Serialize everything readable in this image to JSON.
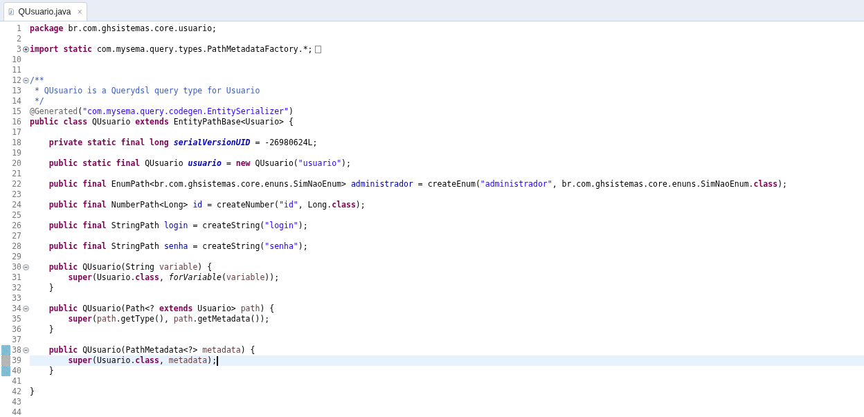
{
  "tab": {
    "title": "QUsuario.java",
    "selected": true
  },
  "lines": [
    {
      "number": "1",
      "current": false,
      "marked": false,
      "tokens": [
        {
          "kind": "kw",
          "text": "package"
        },
        {
          "kind": "plain",
          "text": " br.com.ghsistemas.core.usuario;"
        }
      ]
    },
    {
      "number": "2",
      "current": false,
      "marked": false
    },
    {
      "number": "3",
      "current": false,
      "marked": false,
      "collapsed": true,
      "tokens": [
        {
          "kind": "kw",
          "text": "import static"
        },
        {
          "kind": "plain",
          "text": " com.mysema.query.types.PathMetadataFactory.*;"
        }
      ]
    },
    {
      "number": "10",
      "current": false,
      "marked": false
    },
    {
      "number": "11",
      "current": false,
      "marked": false
    },
    {
      "number": "12",
      "current": false,
      "marked": false,
      "collapsed": false,
      "tokens": [
        {
          "kind": "comment",
          "text": "/**"
        }
      ]
    },
    {
      "number": "13",
      "current": false,
      "marked": false,
      "tokens": [
        {
          "kind": "comment",
          "text": " * QUsuario is a Querydsl query type for Usuario"
        }
      ]
    },
    {
      "number": "14",
      "current": false,
      "marked": false,
      "tokens": [
        {
          "kind": "comment",
          "text": " */"
        }
      ]
    },
    {
      "number": "15",
      "current": false,
      "marked": false,
      "tokens": [
        {
          "kind": "annotation",
          "text": "@Generated"
        },
        {
          "kind": "plain",
          "text": "("
        },
        {
          "kind": "string",
          "text": "\"com.mysema.query.codegen.EntitySerializer\""
        },
        {
          "kind": "plain",
          "text": ")"
        }
      ]
    },
    {
      "number": "16",
      "current": false,
      "marked": false,
      "tokens": [
        {
          "kind": "kw",
          "text": "public class"
        },
        {
          "kind": "plain",
          "text": " QUsuario "
        },
        {
          "kind": "kw",
          "text": "extends"
        },
        {
          "kind": "plain",
          "text": " EntityPathBase<Usuario> {"
        }
      ]
    },
    {
      "number": "17",
      "current": false,
      "marked": false
    },
    {
      "number": "18",
      "current": false,
      "marked": false,
      "tokens": [
        {
          "kind": "kw",
          "text": "    private static final long "
        },
        {
          "kind": "static_field",
          "text": "serialVersionUID"
        },
        {
          "kind": "plain",
          "text": " = -26980624L;"
        }
      ]
    },
    {
      "number": "19",
      "current": false,
      "marked": false
    },
    {
      "number": "20",
      "current": false,
      "marked": false,
      "tokens": [
        {
          "kind": "kw",
          "text": "    public static final"
        },
        {
          "kind": "plain",
          "text": " QUsuario "
        },
        {
          "kind": "static_field",
          "text": "usuario"
        },
        {
          "kind": "plain",
          "text": " = "
        },
        {
          "kind": "kw",
          "text": "new"
        },
        {
          "kind": "plain",
          "text": " QUsuario("
        },
        {
          "kind": "string",
          "text": "\"usuario\""
        },
        {
          "kind": "plain",
          "text": ");"
        }
      ]
    },
    {
      "number": "21",
      "current": false,
      "marked": false
    },
    {
      "number": "22",
      "current": false,
      "marked": false,
      "tokens": [
        {
          "kind": "kw",
          "text": "    public final"
        },
        {
          "kind": "plain",
          "text": " EnumPath<br.com.ghsistemas.core.enuns.SimNaoEnum> "
        },
        {
          "kind": "field",
          "text": "administrador"
        },
        {
          "kind": "plain",
          "text": " = createEnum("
        },
        {
          "kind": "string",
          "text": "\"administrador\""
        },
        {
          "kind": "plain",
          "text": ", br.com.ghsistemas.core.enuns.SimNaoEnum."
        },
        {
          "kind": "kw",
          "text": "class"
        },
        {
          "kind": "plain",
          "text": ");"
        }
      ]
    },
    {
      "number": "23",
      "current": false,
      "marked": false
    },
    {
      "number": "24",
      "current": false,
      "marked": false,
      "tokens": [
        {
          "kind": "kw",
          "text": "    public final"
        },
        {
          "kind": "plain",
          "text": " NumberPath<Long> "
        },
        {
          "kind": "field",
          "text": "id"
        },
        {
          "kind": "plain",
          "text": " = createNumber("
        },
        {
          "kind": "string",
          "text": "\"id\""
        },
        {
          "kind": "plain",
          "text": ", Long."
        },
        {
          "kind": "kw",
          "text": "class"
        },
        {
          "kind": "plain",
          "text": ");"
        }
      ]
    },
    {
      "number": "25",
      "current": false,
      "marked": false
    },
    {
      "number": "26",
      "current": false,
      "marked": false,
      "tokens": [
        {
          "kind": "kw",
          "text": "    public final"
        },
        {
          "kind": "plain",
          "text": " StringPath "
        },
        {
          "kind": "field",
          "text": "login"
        },
        {
          "kind": "plain",
          "text": " = createString("
        },
        {
          "kind": "string",
          "text": "\"login\""
        },
        {
          "kind": "plain",
          "text": ");"
        }
      ]
    },
    {
      "number": "27",
      "current": false,
      "marked": false
    },
    {
      "number": "28",
      "current": false,
      "marked": false,
      "tokens": [
        {
          "kind": "kw",
          "text": "    public final"
        },
        {
          "kind": "plain",
          "text": " StringPath "
        },
        {
          "kind": "field",
          "text": "senha"
        },
        {
          "kind": "plain",
          "text": " = createString("
        },
        {
          "kind": "string",
          "text": "\"senha\""
        },
        {
          "kind": "plain",
          "text": ");"
        }
      ]
    },
    {
      "number": "29",
      "current": false,
      "marked": false
    },
    {
      "number": "30",
      "current": false,
      "marked": false,
      "collapsed": false,
      "tokens": [
        {
          "kind": "kw",
          "text": "    public"
        },
        {
          "kind": "plain",
          "text": " QUsuario(String "
        },
        {
          "kind": "param",
          "text": "variable"
        },
        {
          "kind": "plain",
          "text": ") {"
        }
      ]
    },
    {
      "number": "31",
      "current": false,
      "marked": false,
      "tokens": [
        {
          "kind": "kw",
          "text": "        super"
        },
        {
          "kind": "plain",
          "text": "(Usuario."
        },
        {
          "kind": "kw",
          "text": "class"
        },
        {
          "kind": "plain",
          "text": ", "
        },
        {
          "kind": "static_method",
          "text": "forVariable"
        },
        {
          "kind": "plain",
          "text": "("
        },
        {
          "kind": "param",
          "text": "variable"
        },
        {
          "kind": "plain",
          "text": "));"
        }
      ]
    },
    {
      "number": "32",
      "current": false,
      "marked": false,
      "tokens": [
        {
          "kind": "plain",
          "text": "    }"
        }
      ]
    },
    {
      "number": "33",
      "current": false,
      "marked": false
    },
    {
      "number": "34",
      "current": false,
      "marked": false,
      "collapsed": false,
      "tokens": [
        {
          "kind": "kw",
          "text": "    public"
        },
        {
          "kind": "plain",
          "text": " QUsuario(Path<? "
        },
        {
          "kind": "kw",
          "text": "extends"
        },
        {
          "kind": "plain",
          "text": " Usuario> "
        },
        {
          "kind": "param",
          "text": "path"
        },
        {
          "kind": "plain",
          "text": ") {"
        }
      ]
    },
    {
      "number": "35",
      "current": false,
      "marked": false,
      "tokens": [
        {
          "kind": "kw",
          "text": "        super"
        },
        {
          "kind": "plain",
          "text": "("
        },
        {
          "kind": "param",
          "text": "path"
        },
        {
          "kind": "plain",
          "text": ".getType(), "
        },
        {
          "kind": "param",
          "text": "path"
        },
        {
          "kind": "plain",
          "text": ".getMetadata());"
        }
      ]
    },
    {
      "number": "36",
      "current": false,
      "marked": false,
      "tokens": [
        {
          "kind": "plain",
          "text": "    }"
        }
      ]
    },
    {
      "number": "37",
      "current": false,
      "marked": false
    },
    {
      "number": "38",
      "current": false,
      "marked": true,
      "collapsed": false,
      "tokens": [
        {
          "kind": "kw",
          "text": "    public"
        },
        {
          "kind": "plain",
          "text": " QUsuario(PathMetadata<?> "
        },
        {
          "kind": "param",
          "text": "metadata"
        },
        {
          "kind": "plain",
          "text": ") {"
        }
      ]
    },
    {
      "number": "39",
      "current": true,
      "marked": true,
      "tokens": [
        {
          "kind": "kw",
          "text": "        super"
        },
        {
          "kind": "plain",
          "text": "(Usuario."
        },
        {
          "kind": "kw",
          "text": "class"
        },
        {
          "kind": "plain",
          "text": ", "
        },
        {
          "kind": "param",
          "text": "metadata"
        },
        {
          "kind": "plain",
          "text": ");"
        }
      ]
    },
    {
      "number": "40",
      "current": false,
      "marked": true,
      "tokens": [
        {
          "kind": "plain",
          "text": "    }"
        }
      ]
    },
    {
      "number": "41",
      "current": false,
      "marked": false
    },
    {
      "number": "42",
      "current": false,
      "marked": false,
      "tokens": [
        {
          "kind": "plain",
          "text": "}"
        }
      ]
    },
    {
      "number": "43",
      "current": false,
      "marked": false
    },
    {
      "number": "44",
      "current": false,
      "marked": false
    }
  ]
}
